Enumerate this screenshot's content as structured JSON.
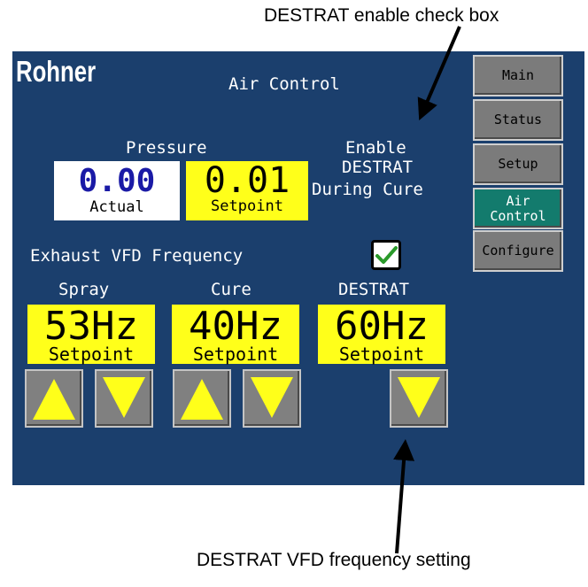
{
  "callouts": {
    "top": "DESTRAT enable check box",
    "bottom": "DESTRAT VFD frequency setting"
  },
  "screen": {
    "logo": "Rohner",
    "title": "Air Control",
    "nav": {
      "main": "Main",
      "status": "Status",
      "setup": "Setup",
      "air_control_line1": "Air",
      "air_control_line2": "Control",
      "configure": "Configure",
      "active": "Air Control"
    },
    "pressure": {
      "label": "Pressure",
      "actual_value": "0.00",
      "actual_label": "Actual",
      "setpoint_value": "0.01",
      "setpoint_label": "Setpoint"
    },
    "destrat_enable": {
      "line1": "Enable",
      "line2": "DESTRAT",
      "line3": "During Cure",
      "checked": true
    },
    "exhaust_label": "Exhaust VFD Frequency",
    "vfd": {
      "spray": {
        "label": "Spray",
        "value": "53Hz",
        "sub": "Setpoint"
      },
      "cure": {
        "label": "Cure",
        "value": "40Hz",
        "sub": "Setpoint"
      },
      "destrat": {
        "label": "DESTRAT",
        "value": "60Hz",
        "sub": "Setpoint"
      }
    },
    "icons": {
      "up": "arrow-up-icon",
      "down": "arrow-down-icon",
      "check": "checkmark-icon"
    },
    "colors": {
      "background": "#1b3f6d",
      "setpoint_yellow": "#ffff1a",
      "active_nav": "#137b6d",
      "button_gray": "#808080",
      "check_green": "#2a9a2a"
    }
  }
}
